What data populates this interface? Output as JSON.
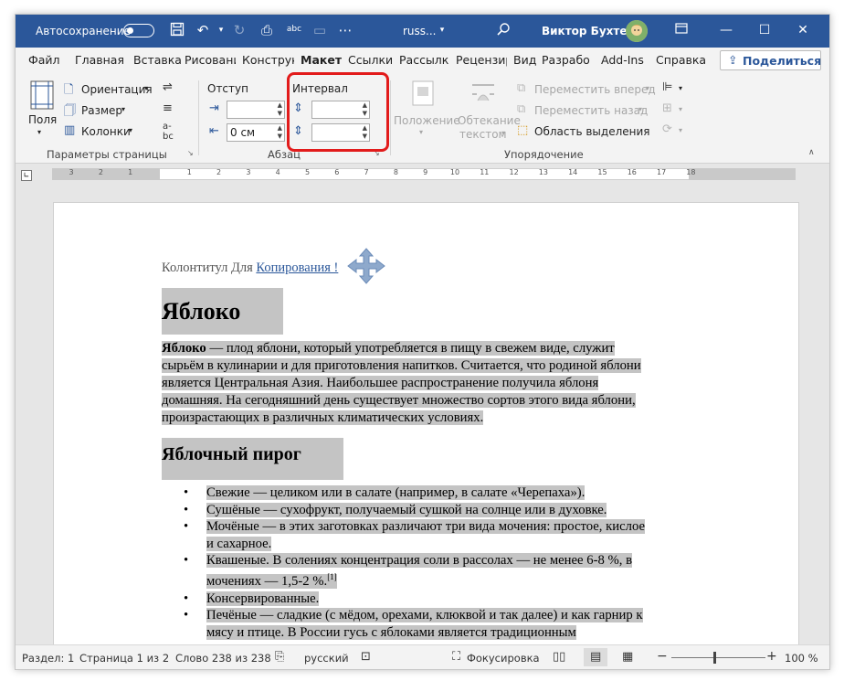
{
  "titlebar": {
    "autosave_label": "Автосохранение",
    "doc_name": "russ...",
    "user_name": "Виктор Бухтеев"
  },
  "tabs": [
    "Файл",
    "Главная",
    "Вставка",
    "Рисовани",
    "Конструк",
    "Макет",
    "Ссылки",
    "Рассылки",
    "Рецензир",
    "Вид",
    "Разрабо",
    "Add-Ins",
    "Справка"
  ],
  "share_label": "Поделиться",
  "ribbon": {
    "fields_label": "Поля",
    "orientation_label": "Ориентация",
    "size_label": "Размер",
    "columns_label": "Колонки",
    "page_setup_group": "Параметры страницы",
    "indent_label": "Отступ",
    "spacing_label": "Интервал",
    "indent_left_value": "",
    "indent_right_value": "0 см",
    "spacing_before_value": "",
    "spacing_after_value": "",
    "paragraph_group": "Абзац",
    "position_label": "Положение",
    "wrap_label_1": "Обтекание",
    "wrap_label_2": "текстом",
    "bring_forward_label": "Переместить вперед",
    "send_backward_label": "Переместить назад",
    "selection_pane_label": "Область выделения",
    "arrange_group": "Упорядочение"
  },
  "ruler_labels": [
    "3",
    "2",
    "1",
    "1",
    "2",
    "3",
    "4",
    "5",
    "6",
    "7",
    "8",
    "9",
    "10",
    "11",
    "12",
    "13",
    "14",
    "15",
    "16",
    "17",
    "18"
  ],
  "document": {
    "header_text": "Колонтитул Для ",
    "header_link": "Копирования !",
    "heading1": "Яблоко",
    "para_bold": "Яблоко",
    "para_lines": [
      " — плод яблони, который употребляется в пищу в свежем виде, служит",
      "сырьём в кулинарии и для приготовления напитков. Считается, что родиной яблони",
      "является Центральная Азия. Наибольшее распространение получила яблоня",
      "домашняя. На сегодняшний день существует множество сортов этого вида яблони,",
      "произрастающих в различных климатических условиях."
    ],
    "heading2": "Яблочный пирог",
    "list_lines": [
      [
        "Свежие — целиком или в салате (например, в салате «Черепаха»)."
      ],
      [
        "Сушёные — сухофрукт, получаемый сушкой на солнце или в духовке."
      ],
      [
        "Мочёные — в этих заготовках различают три вида мочения: простое, кислое",
        "и сахарное."
      ],
      [
        "Квашеные. В солениях концентрация соли в рассолах — не менее 6-8 %, в",
        "мочениях — 1,5-2 %."
      ],
      [
        "Консервированные."
      ],
      [
        "Печёные — сладкие (с мёдом, орехами, клюквой и так далее) и как гарнир к",
        "мясу и птице. В России гусь с яблоками является традиционным"
      ]
    ],
    "footnote_ref": "[1]"
  },
  "status": {
    "section": "Раздел: 1",
    "page": "Страница 1 из 2",
    "words": "Слово 238 из 238",
    "language": "русский",
    "focus": "Фокусировка",
    "zoom": "100 %"
  }
}
